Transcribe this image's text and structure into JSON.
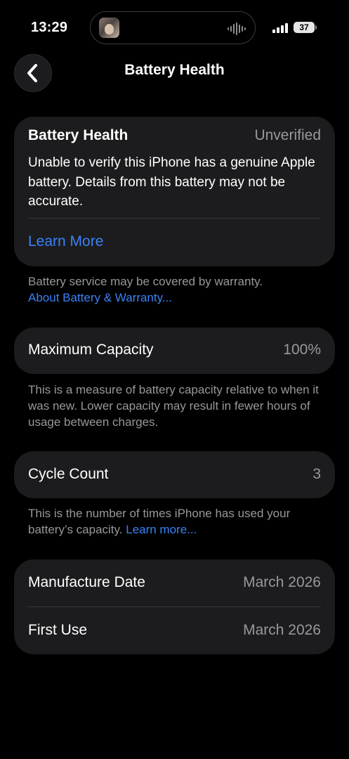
{
  "status_bar": {
    "time": "13:29",
    "battery_level": "37",
    "icons": {
      "avatar": "contact-avatar-icon",
      "waveform": "audio-waveform-icon",
      "signal": "cellular-signal-icon",
      "battery": "battery-icon"
    }
  },
  "nav": {
    "title": "Battery Health",
    "back_icon": "chevron-left-icon"
  },
  "health_card": {
    "label": "Battery Health",
    "value": "Unverified",
    "message": "Unable to verify this iPhone has a genuine Apple battery. Details from this battery may not be accurate.",
    "link": "Learn More"
  },
  "warranty_note": {
    "text": "Battery service may be covered by warranty.",
    "link": "About Battery & Warranty..."
  },
  "capacity": {
    "label": "Maximum Capacity",
    "value": "100%",
    "note": "This is a measure of battery capacity relative to when it was new. Lower capacity may result in fewer hours of usage between charges."
  },
  "cycle": {
    "label": "Cycle Count",
    "value": "3",
    "note_text": "This is the number of times iPhone has used your battery’s capacity.",
    "note_link": "Learn more..."
  },
  "dates": {
    "manufacture_label": "Manufacture Date",
    "manufacture_value": "March 2026",
    "first_use_label": "First Use",
    "first_use_value": "March 2026"
  },
  "colors": {
    "background": "#000000",
    "card": "#1c1c1e",
    "link": "#3a82f7",
    "secondary_text": "#98989d"
  }
}
